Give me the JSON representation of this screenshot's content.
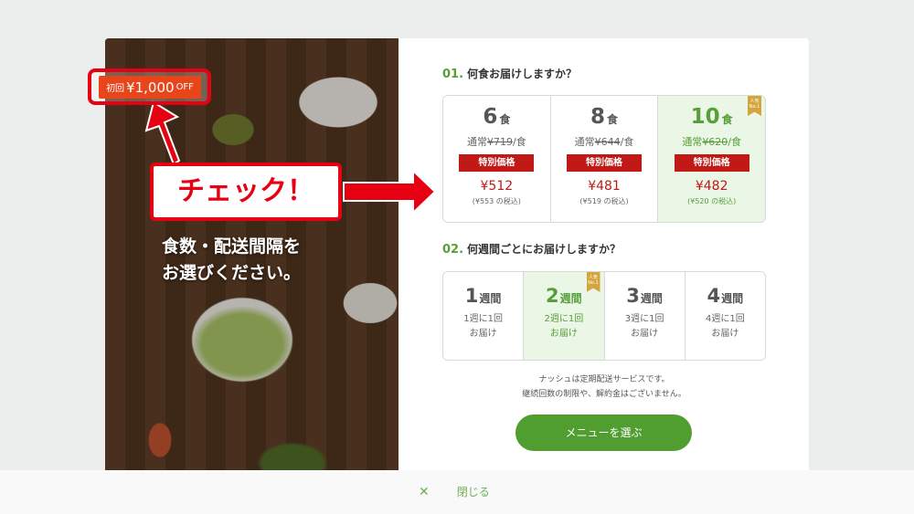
{
  "promo_badge": {
    "prefix": "初回",
    "amount": "¥1,000",
    "suffix": "OFF"
  },
  "annotation": {
    "check": "チェック！"
  },
  "photo": {
    "caption": "食数・配送間隔を\nお選びください。"
  },
  "section1": {
    "number": "01.",
    "title": "何食お届けしますか？"
  },
  "quantity_options": [
    {
      "count": "6",
      "unit": "食",
      "regular_prefix": "通常",
      "regular_price": "¥719",
      "regular_suffix": "/食",
      "special_label": "特別価格",
      "price": "¥512",
      "tax_in": "(¥553 の税込)",
      "selected": false
    },
    {
      "count": "8",
      "unit": "食",
      "regular_prefix": "通常",
      "regular_price": "¥644",
      "regular_suffix": "/食",
      "special_label": "特別価格",
      "price": "¥481",
      "tax_in": "(¥519 の税込)",
      "selected": false
    },
    {
      "count": "10",
      "unit": "食",
      "regular_prefix": "通常",
      "regular_price": "¥620",
      "regular_suffix": "/食",
      "special_label": "特別価格",
      "price": "¥482",
      "tax_in": "(¥520 の税込)",
      "selected": true,
      "ribbon": "人気 No.1"
    }
  ],
  "section2": {
    "number": "02.",
    "title": "何週間ごとにお届けしますか？"
  },
  "week_options": [
    {
      "num": "1",
      "unit": "週間",
      "line1": "1週に1回",
      "line2": "お届け",
      "selected": false
    },
    {
      "num": "2",
      "unit": "週間",
      "line1": "2週に1回",
      "line2": "お届け",
      "selected": true,
      "ribbon": "人気 No.1"
    },
    {
      "num": "3",
      "unit": "週間",
      "line1": "3週に1回",
      "line2": "お届け",
      "selected": false
    },
    {
      "num": "4",
      "unit": "週間",
      "line1": "4週に1回",
      "line2": "お届け",
      "selected": false
    }
  ],
  "note": {
    "line1": "ナッシュは定期配送サービスです。",
    "line2": "継続回数の制限や、解約金はございません。"
  },
  "cta": {
    "label": "メニューを選ぶ"
  },
  "footer": {
    "close_label": "閉じる"
  },
  "colors": {
    "accent_green": "#57a039",
    "price_red": "#c11a16",
    "annotation_red": "#e60012"
  }
}
